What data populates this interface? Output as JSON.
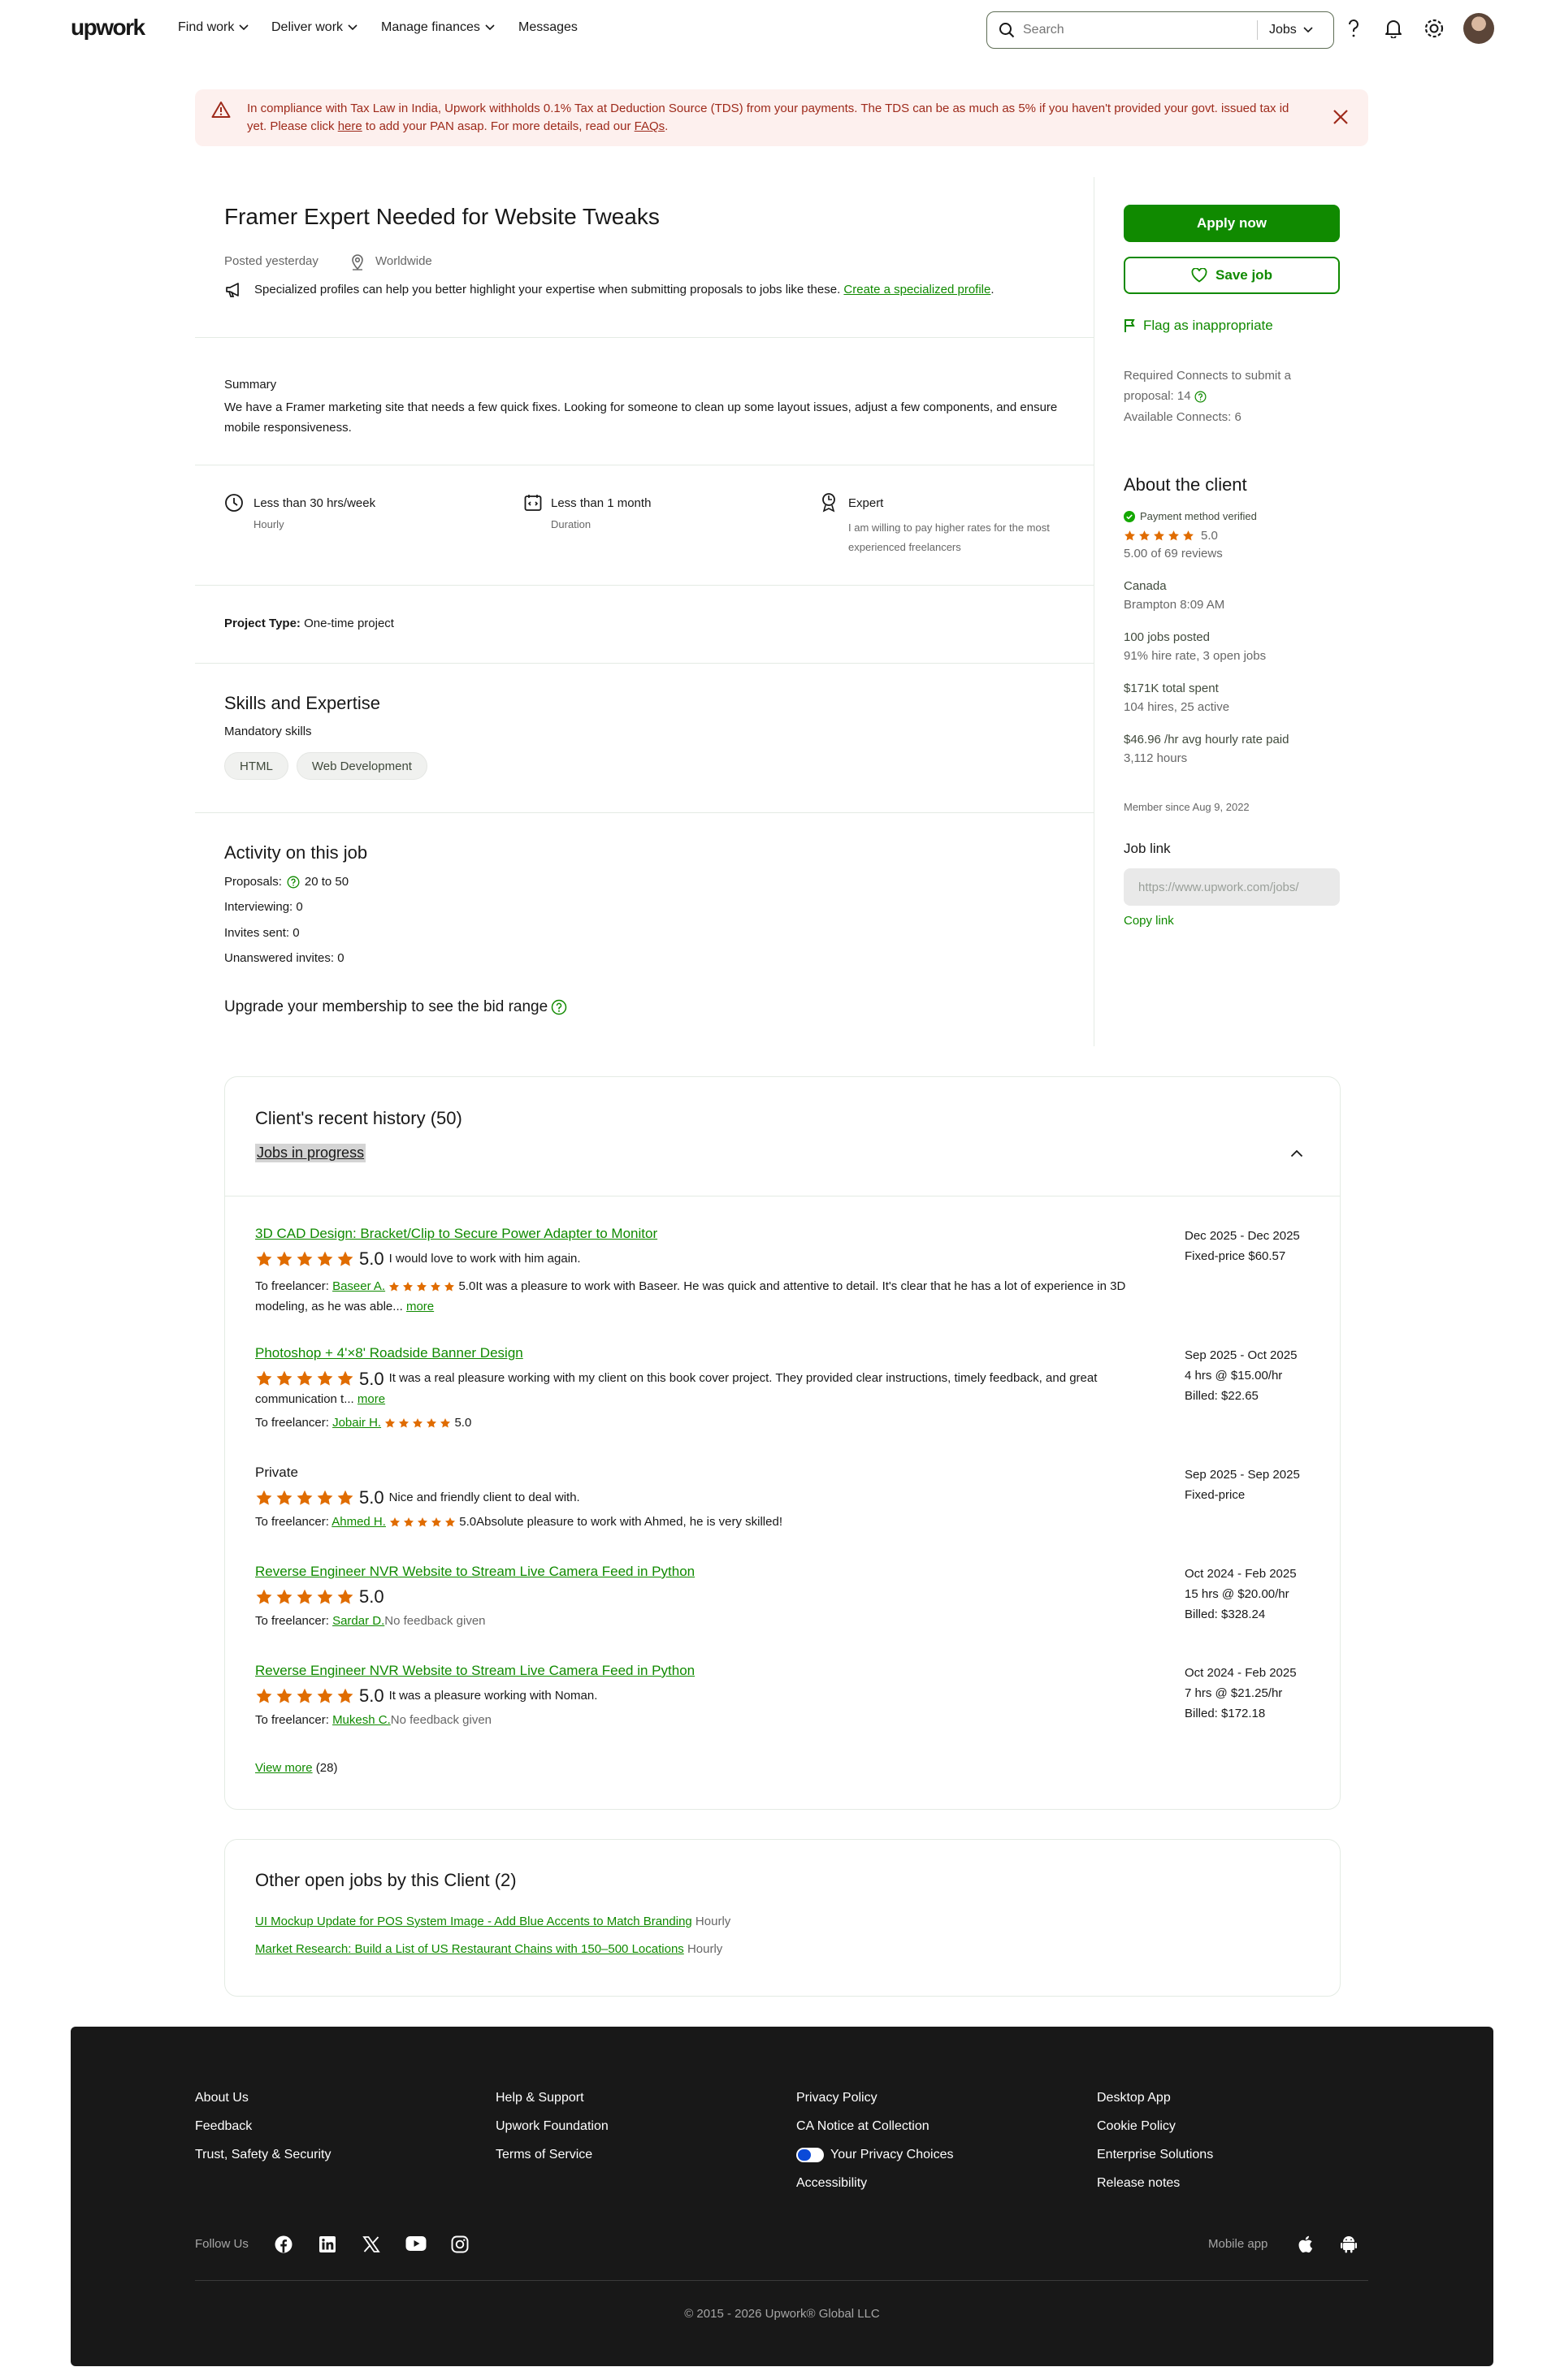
{
  "nav": {
    "logo": "upwork",
    "links": [
      "Find work",
      "Deliver work",
      "Manage finances",
      "Messages"
    ],
    "search_placeholder": "Search",
    "search_scope": "Jobs"
  },
  "banner": {
    "text_before_here": "In compliance with Tax Law in India, Upwork withholds 0.1% Tax at Deduction Source (TDS) from your payments. The TDS can be as much as 5% if you haven't provided your govt. issued tax id yet. Please click ",
    "here": "here",
    "text_after_here": " to add your PAN asap. For more details, read our ",
    "faqs": "FAQs",
    "end": "."
  },
  "job": {
    "title": "Framer Expert Needed for Website Tweaks",
    "posted": "Posted yesterday",
    "location": "Worldwide",
    "specialized_text": "Specialized profiles can help you better highlight your expertise when submitting proposals to jobs like these. ",
    "specialized_link": "Create a specialized profile",
    "specialized_end": ".",
    "summary_label": "Summary",
    "summary": "We have a Framer marketing site that needs a few quick fixes. Looking for someone to clean up some layout issues, adjust a few components, and ensure mobile responsiveness.",
    "features": [
      {
        "title": "Less than 30 hrs/week",
        "sub": "Hourly"
      },
      {
        "title": "Less than 1 month",
        "sub": "Duration"
      },
      {
        "title": "Expert",
        "sub": "I am willing to pay higher rates for the most experienced freelancers"
      }
    ],
    "project_type_label": "Project Type:",
    "project_type": " One-time project",
    "skills_title": "Skills and Expertise",
    "skills_sub": "Mandatory skills",
    "skills": [
      "HTML",
      "Web Development"
    ],
    "activity_title": "Activity on this job",
    "activity": {
      "proposals_label": "Proposals:",
      "proposals": "20 to 50",
      "interviewing": "Interviewing: 0",
      "invites": "Invites sent: 0",
      "unanswered": "Unanswered invites: 0"
    },
    "upgrade": "Upgrade your membership to see the bid range"
  },
  "sidebar": {
    "apply": "Apply now",
    "save": "Save job",
    "flag": "Flag as inappropriate",
    "connects_required": "Required Connects to submit a proposal: 14",
    "connects_available": "Available Connects: 6",
    "about_title": "About the client",
    "payment_verified": "Payment method verified",
    "rating": "5.0",
    "reviews": "5.00 of 69 reviews",
    "country": "Canada",
    "city_time": "Brampton 8:09 AM",
    "jobs_posted": "100 jobs posted",
    "hire_rate": "91% hire rate, 3 open jobs",
    "total_spent": "$171K total spent",
    "hires": "104 hires, 25 active",
    "avg_rate": "$46.96 /hr avg hourly rate paid",
    "hours": "3,112 hours",
    "member_since": "Member since Aug 9, 2022",
    "job_link_title": "Job link",
    "job_link_value": "https://www.upwork.com/jobs/",
    "copy_link": "Copy link"
  },
  "history": {
    "title": "Client's recent history (50)",
    "tab": "Jobs in progress",
    "items": [
      {
        "title": "3D CAD Design: Bracket/Clip to Secure Power Adapter to Monitor",
        "rating": "5.0",
        "feedback": "I would love to work with him again.",
        "to_label": "To freelancer:",
        "freelancer": "Baseer A.",
        "fl_rating": "5.0",
        "fl_feedback": "It was a pleasure to work with Baseer. He was quick and attentive to detail. It's clear that he has a lot of experience in 3D modeling, as he was able...",
        "more": "more",
        "date": "Dec 2025 - Dec 2025",
        "price": "Fixed-price $60.57",
        "billed": ""
      },
      {
        "title": "Photoshop + 4'×8' Roadside Banner Design",
        "rating": "5.0",
        "feedback": "It was a real pleasure working with my client on this book cover project. They provided clear instructions, timely feedback, and great communication t...",
        "more": "more",
        "to_label": "To freelancer:",
        "freelancer": "Jobair H.",
        "fl_rating": "5.0",
        "fl_feedback": "",
        "date": "Sep 2025 - Oct 2025",
        "price": "4 hrs @ $15.00/hr",
        "billed": "Billed: $22.65"
      },
      {
        "title": "Private",
        "rating": "5.0",
        "feedback": "Nice and friendly client to deal with.",
        "to_label": "To freelancer:",
        "freelancer": "Ahmed H.",
        "fl_rating": "5.0",
        "fl_feedback": "Absolute pleasure to work with Ahmed, he is very skilled!",
        "date": "Sep 2025 - Sep 2025",
        "price": "Fixed-price",
        "billed": ""
      },
      {
        "title": "Reverse Engineer NVR Website to Stream Live Camera Feed in Python",
        "rating": "5.0",
        "feedback": "",
        "to_label": "To freelancer:",
        "freelancer": "Sardar D.",
        "fl_feedback": "No feedback given",
        "date": "Oct 2024 - Feb 2025",
        "price": "15 hrs @ $20.00/hr",
        "billed": "Billed: $328.24"
      },
      {
        "title": "Reverse Engineer NVR Website to Stream Live Camera Feed in Python",
        "rating": "5.0",
        "feedback": "It was a pleasure working with Noman.",
        "to_label": "To freelancer:",
        "freelancer": "Mukesh C.",
        "fl_feedback": "No feedback given",
        "date": "Oct 2024 - Feb 2025",
        "price": "7 hrs @ $21.25/hr",
        "billed": "Billed: $172.18"
      }
    ],
    "view_more": "View more",
    "view_more_count": " (28)"
  },
  "other_jobs": {
    "title": "Other open jobs by this Client (2)",
    "items": [
      {
        "title": "UI Mockup Update for POS System Image - Add Blue Accents to Match Branding",
        "type": " Hourly"
      },
      {
        "title": "Market Research: Build a List of US Restaurant Chains with 150–500 Locations",
        "type": " Hourly"
      }
    ]
  },
  "footer": {
    "col1": [
      "About Us",
      "Feedback",
      "Trust, Safety & Security"
    ],
    "col2": [
      "Help & Support",
      "Upwork Foundation",
      "Terms of Service"
    ],
    "col3": [
      "Privacy Policy",
      "CA Notice at Collection",
      "Your Privacy Choices",
      "Accessibility"
    ],
    "col4": [
      "Desktop App",
      "Cookie Policy",
      "Enterprise Solutions",
      "Release notes"
    ],
    "follow_us": "Follow Us",
    "mobile_app": "Mobile app",
    "copyright": "© 2015 - 2026 Upwork® Global LLC"
  },
  "colors": {
    "brand": "#108a00",
    "star": "#e06c00",
    "banner_bg": "#fdf0ee",
    "banner_text": "#9e2a1b",
    "footer_bg": "#181818"
  }
}
